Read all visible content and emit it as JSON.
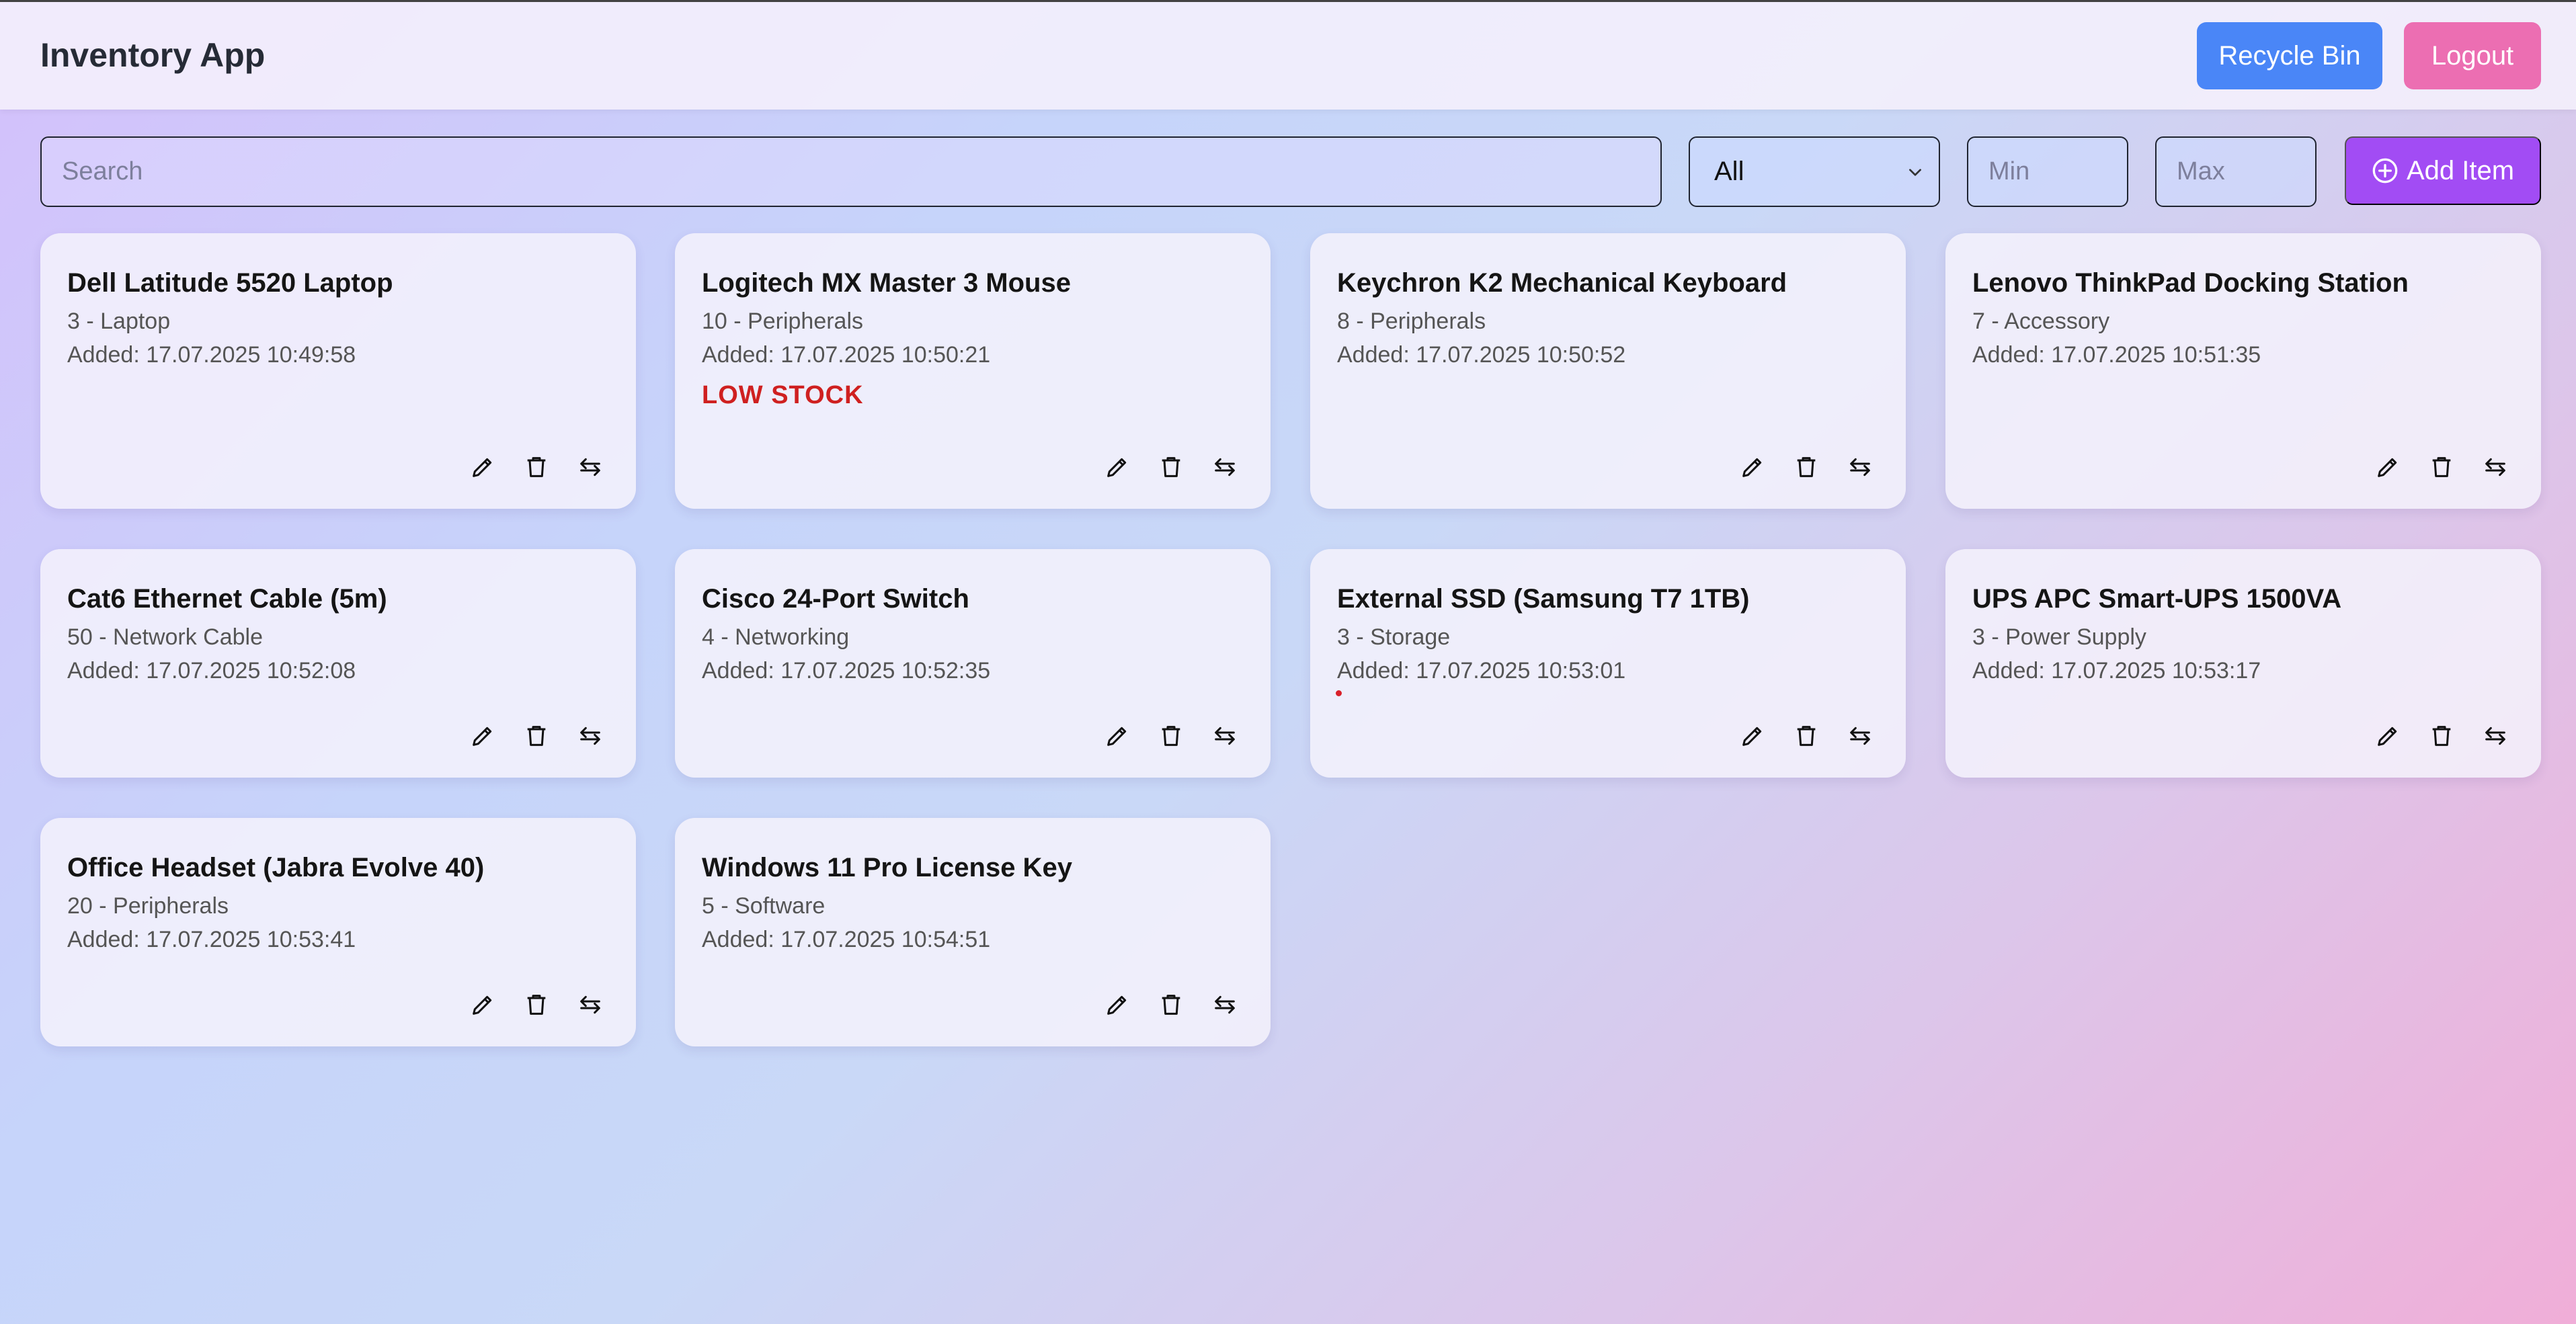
{
  "header": {
    "title": "Inventory App",
    "recycle_bin_label": "Recycle Bin",
    "logout_label": "Logout"
  },
  "toolbar": {
    "search_placeholder": "Search",
    "category_selected": "All",
    "min_placeholder": "Min",
    "max_placeholder": "Max",
    "add_item_label": "Add Item"
  },
  "items": [
    {
      "name": "Dell Latitude 5520 Laptop",
      "meta": "3 - Laptop",
      "added": "Added: 17.07.2025 10:49:58",
      "flag": ""
    },
    {
      "name": "Logitech MX Master 3 Mouse",
      "meta": "10 - Peripherals",
      "added": "Added: 17.07.2025 10:50:21",
      "flag": "LOW STOCK"
    },
    {
      "name": "Keychron K2 Mechanical Keyboard",
      "meta": "8 - Peripherals",
      "added": "Added: 17.07.2025 10:50:52",
      "flag": ""
    },
    {
      "name": "Lenovo ThinkPad Docking Station",
      "meta": "7 - Accessory",
      "added": "Added: 17.07.2025 10:51:35",
      "flag": ""
    },
    {
      "name": "Cat6 Ethernet Cable (5m)",
      "meta": "50 - Network Cable",
      "added": "Added: 17.07.2025 10:52:08",
      "flag": ""
    },
    {
      "name": "Cisco 24-Port Switch",
      "meta": "4 - Networking",
      "added": "Added: 17.07.2025 10:52:35",
      "flag": ""
    },
    {
      "name": "External SSD (Samsung T7 1TB)",
      "meta": "3 - Storage",
      "added": "Added: 17.07.2025 10:53:01",
      "flag": ""
    },
    {
      "name": "UPS APC Smart-UPS 1500VA",
      "meta": "3 - Power Supply",
      "added": "Added: 17.07.2025 10:53:17",
      "flag": ""
    },
    {
      "name": "Office Headset (Jabra Evolve 40)",
      "meta": "20 - Peripherals",
      "added": "Added: 17.07.2025 10:53:41",
      "flag": ""
    },
    {
      "name": "Windows 11 Pro License Key",
      "meta": "5 - Software",
      "added": "Added: 17.07.2025 10:54:51",
      "flag": ""
    }
  ],
  "colors": {
    "recycle_bin": "#4a86f7",
    "logout": "#ec6eb2",
    "add_item": "#a24cf4",
    "low_stock": "#cf2020"
  },
  "icons": {
    "edit": "pencil-icon",
    "delete": "trash-icon",
    "transfer": "arrows-exchange-icon",
    "add": "plus-circle-icon",
    "select": "chevron-down-icon"
  }
}
